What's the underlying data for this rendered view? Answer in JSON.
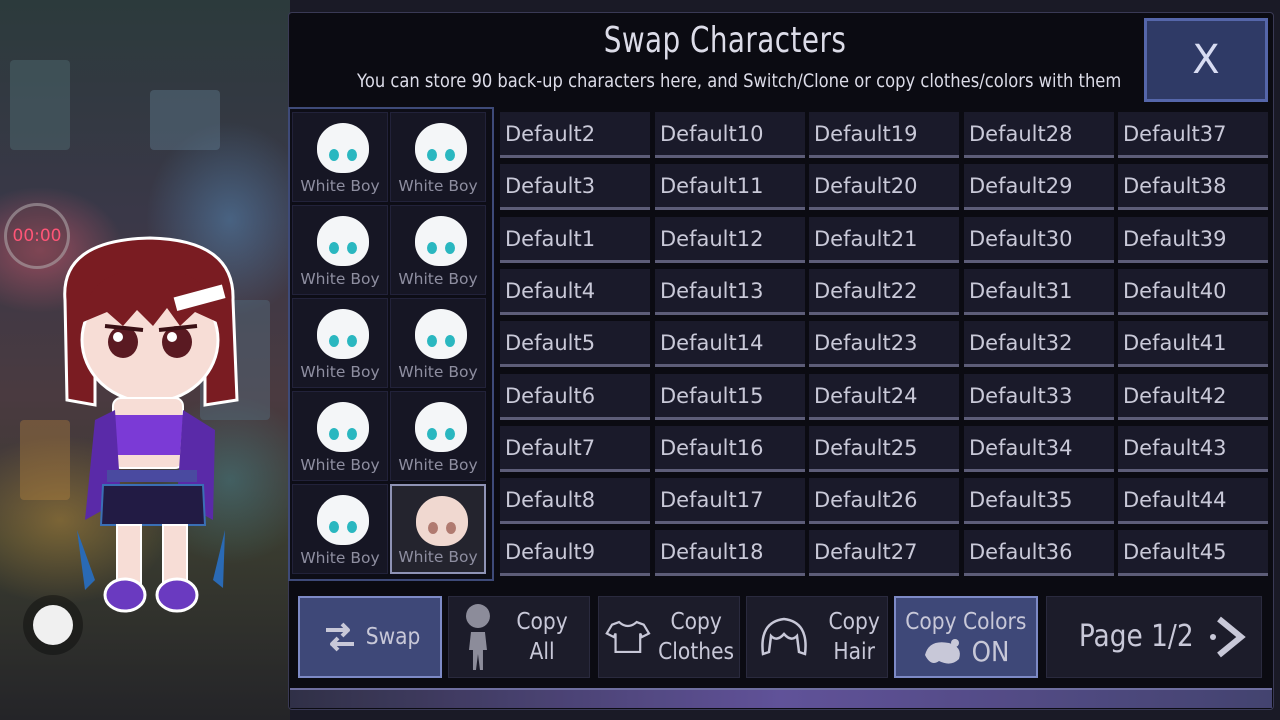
{
  "scene": {
    "timer": "00:00"
  },
  "panel": {
    "title": "Swap Characters",
    "subtitle": "You can store 90 back-up characters here, and Switch/Clone or copy clothes/colors with them",
    "close_label": "X"
  },
  "favorites": [
    {
      "name": "White Boy"
    },
    {
      "name": "White Boy"
    },
    {
      "name": "White Boy"
    },
    {
      "name": "White Boy"
    },
    {
      "name": "White Boy"
    },
    {
      "name": "White Boy"
    },
    {
      "name": "White Boy"
    },
    {
      "name": "White Boy"
    },
    {
      "name": "White Boy"
    },
    {
      "name": "White Boy",
      "selected": true
    }
  ],
  "slots": [
    [
      "Default2",
      "Default10",
      "Default19",
      "Default28",
      "Default37"
    ],
    [
      "Default3",
      "Default11",
      "Default20",
      "Default29",
      "Default38"
    ],
    [
      "Default1",
      "Default12",
      "Default21",
      "Default30",
      "Default39"
    ],
    [
      "Default4",
      "Default13",
      "Default22",
      "Default31",
      "Default40"
    ],
    [
      "Default5",
      "Default14",
      "Default23",
      "Default32",
      "Default41"
    ],
    [
      "Default6",
      "Default15",
      "Default24",
      "Default33",
      "Default42"
    ],
    [
      "Default7",
      "Default16",
      "Default25",
      "Default34",
      "Default43"
    ],
    [
      "Default8",
      "Default17",
      "Default26",
      "Default35",
      "Default44"
    ],
    [
      "Default9",
      "Default18",
      "Default27",
      "Default36",
      "Default45"
    ]
  ],
  "buttons": {
    "swap": "Swap",
    "copy_all": "Copy All",
    "copy_clothes_1": "Copy",
    "copy_clothes_2": "Clothes",
    "copy_hair_1": "Copy",
    "copy_hair_2": "Hair",
    "copy_colors_1": "Copy Colors",
    "copy_colors_2": "ON",
    "page": "Page 1/2"
  },
  "colors": {
    "accent": "#3e4878",
    "eye": "#2ab7c0",
    "timer": "#ff5577"
  }
}
